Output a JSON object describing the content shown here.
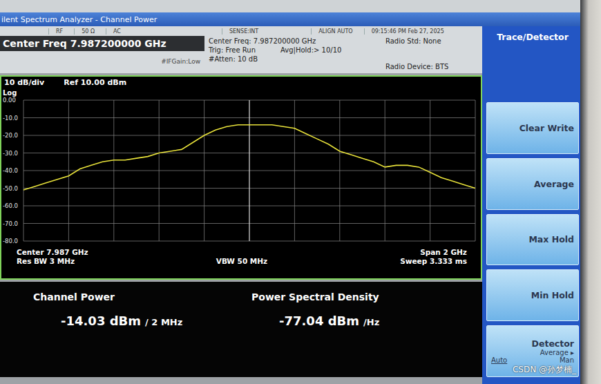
{
  "window": {
    "title": "ilent Spectrum Analyzer - Channel Power"
  },
  "status": [
    "RF",
    "50 Ω",
    "AC",
    "SENSE:INT",
    "ALIGN AUTO",
    "09:15:46 PM Feb 27, 2025"
  ],
  "center_freq": "Center Freq 7.987200000 GHz",
  "if_gain": "#IFGain:Low",
  "settings": [
    [
      "Center Freq: 7.987200000 GHz"
    ],
    [
      "Trig: Free Run",
      "Avg|Hold:> 10/10"
    ],
    [
      "#Atten: 10 dB"
    ]
  ],
  "radio": [
    "Radio Std: None",
    "Radio Device: BTS"
  ],
  "chart": {
    "scale": "10 dB/div",
    "ref": "Ref 10.00 dBm",
    "scale_type": "Log",
    "y_ticks": [
      "0.00",
      "-10.0",
      "-20.0",
      "-30.0",
      "-40.0",
      "-50.0",
      "-60.0",
      "-70.0",
      "-80.0"
    ],
    "series": [
      {
        "name": "trace",
        "color": "#e8e23a",
        "values": [
          -51,
          -49,
          -47,
          -45,
          -43,
          -39,
          -37,
          -35,
          -34,
          -34,
          -33,
          -32,
          -30,
          -29,
          -28,
          -24,
          -20,
          -17,
          -15,
          -14,
          -14,
          -14,
          -14,
          -15,
          -16,
          -19,
          -22,
          -25,
          -29,
          -31,
          -33,
          -35,
          -38,
          -37,
          -37,
          -38,
          -41,
          -44,
          -46,
          -48,
          -50
        ]
      }
    ],
    "footer": {
      "center": "Center 7.987 GHz",
      "rbw": "Res BW 3 MHz",
      "vbw": "VBW 50 MHz",
      "span": "Span 2 GHz",
      "sweep": "Sweep 3.333 ms"
    }
  },
  "results": [
    {
      "label": "Channel Power",
      "value": "-14.03 dBm",
      "unit": "/ 2 MHz"
    },
    {
      "label": "Power Spectral Density",
      "value": "-77.04 dBm",
      "unit": "/Hz"
    }
  ],
  "softkeys": {
    "title": "Trace/Detector",
    "items": [
      {
        "kind": "button",
        "label": "Clear Write"
      },
      {
        "kind": "button",
        "label": "Average"
      },
      {
        "kind": "button",
        "label": "Max Hold"
      },
      {
        "kind": "button",
        "label": "Min Hold"
      },
      {
        "kind": "detector",
        "label": "Detector",
        "sub": "Average ▸",
        "options": [
          {
            "label": "Auto",
            "selected": true
          },
          {
            "label": "Man",
            "selected": false
          }
        ]
      }
    ]
  },
  "watermark": "CSDN @孙梦楠_"
}
